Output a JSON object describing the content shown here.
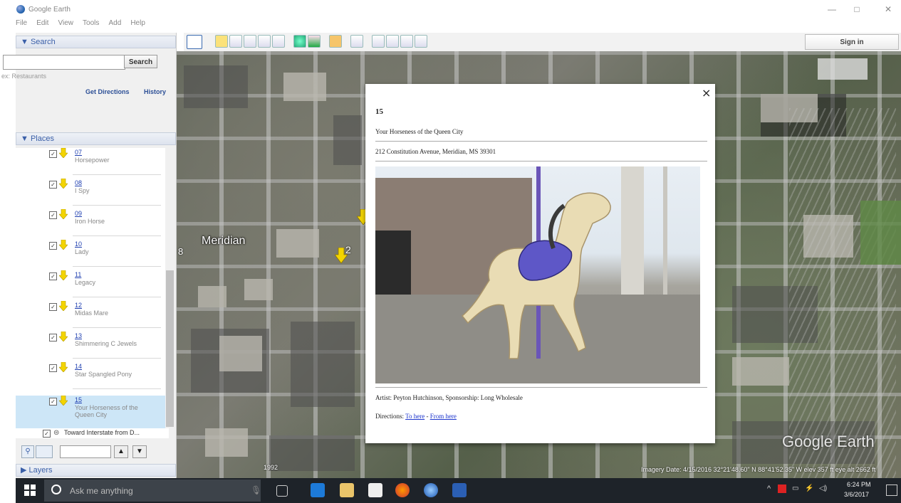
{
  "window": {
    "title": "Google Earth",
    "controls": [
      "—",
      "□",
      "✕"
    ]
  },
  "menu": [
    "File",
    "Edit",
    "View",
    "Tools",
    "Add",
    "Help"
  ],
  "search": {
    "header": "▼ Search",
    "input_value": "",
    "button_label": "Search",
    "hint": "ex: Restaurants",
    "get_directions": "Get Directions",
    "history": "History"
  },
  "places": {
    "header": "▼ Places",
    "items": [
      {
        "num": "07",
        "name": "Horsepower"
      },
      {
        "num": "08",
        "name": "I Spy"
      },
      {
        "num": "09",
        "name": "Iron Horse"
      },
      {
        "num": "10",
        "name": "Lady"
      },
      {
        "num": "11",
        "name": "Legacy"
      },
      {
        "num": "12",
        "name": "Midas Mare"
      },
      {
        "num": "13",
        "name": "Shimmering C Jewels"
      },
      {
        "num": "14",
        "name": "Star Spangled Pony"
      },
      {
        "num": "15",
        "name": "Your Horseness of the Queen City",
        "selected": true
      }
    ],
    "toward_item": "Toward Interstate from D..."
  },
  "layers": {
    "header": "▶ Layers"
  },
  "toolbar": {
    "signin_label": "Sign in"
  },
  "map": {
    "city_label": "Meridian",
    "label_2": "2",
    "label_3": "8",
    "logo": "Google Earth",
    "status": "Imagery Date: 4/15/2016   32°21'48.60\" N  88°41'52.35\" W  elev  357 ft   eye alt  2662 ft",
    "scale_label": "1992"
  },
  "balloon": {
    "close": "×",
    "number": "15",
    "title": "Your Horseness of the Queen City",
    "address": "212 Constitution Avenue, Meridian, MS 39301",
    "artist": "Artist: Peyton Hutchinson, Sponsorship: Long Wholesale",
    "directions_label": "Directions: ",
    "to_here": "To here",
    "separator": " - ",
    "from_here": "From here"
  },
  "taskbar": {
    "search_placeholder": "Ask me anything",
    "time": "6:24 PM",
    "date": "3/6/2017"
  },
  "colors": {
    "accent": "#3a5fa8",
    "link": "#1a33cc",
    "pin": "#f3d400",
    "taskbar": "#1e2329"
  }
}
